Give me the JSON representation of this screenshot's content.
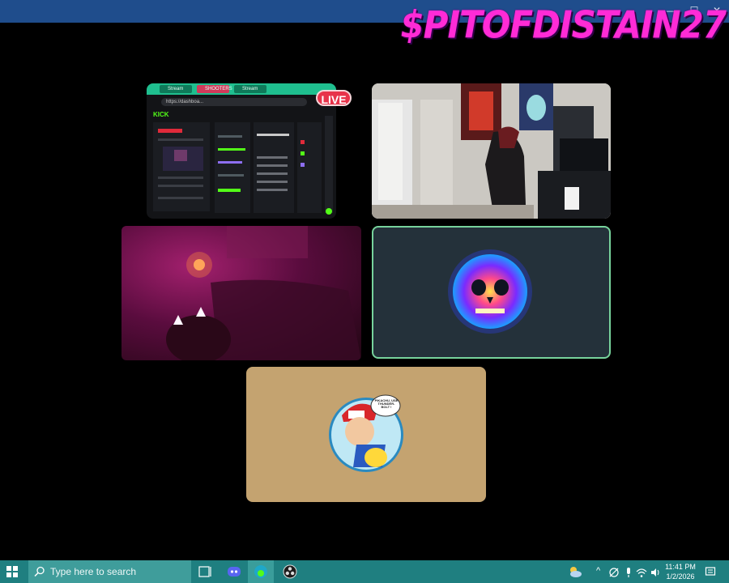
{
  "overlay": {
    "title": "$PITOFDISTAIN27"
  },
  "window_controls": {
    "minimize": "—",
    "maximize": "☐",
    "close": "✕"
  },
  "stream": {
    "live_label": "LIVE"
  },
  "screen_share": {
    "tabs": [
      "Stream",
      "SHOOTERS",
      "Stream"
    ],
    "url": "https://dashboa...",
    "logo": "KICK"
  },
  "taskbar": {
    "search_placeholder": "Type here to search",
    "time": "11:41 PM",
    "date": "1/2/2026"
  },
  "avatar_ash": {
    "speech": "PIKACHU, USE THUNDER-BOLT !"
  },
  "colors": {
    "accent": "#ff2bd6",
    "live": "#e8334a",
    "taskbar": "#1f7f80",
    "topbar": "#1f4d8c"
  }
}
